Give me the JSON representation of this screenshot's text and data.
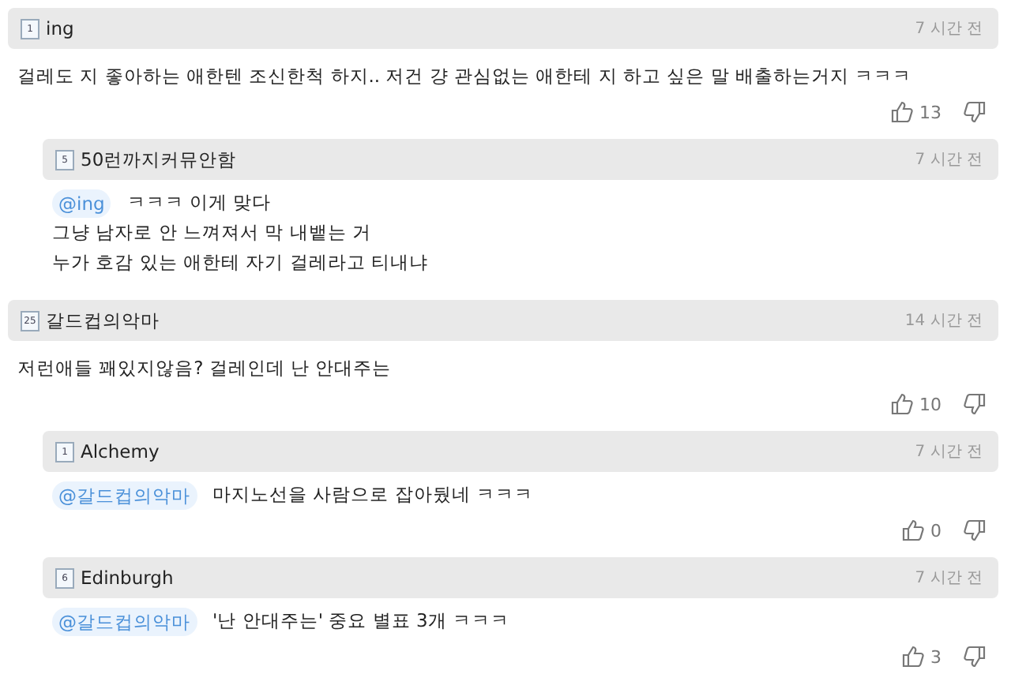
{
  "comments": [
    {
      "author": "ing",
      "badge": "1",
      "time": "7 시간 전",
      "lines": [
        "걸레도 지 좋아하는 애한텐 조신한척 하지.. 저건 걍 관심없는 애한테 지 하고 싶은 말 배출하는거지 ㅋㅋㅋ"
      ],
      "likes": "13",
      "children": [
        {
          "author": "50런까지커뮤안함",
          "badge": "5",
          "time": "7 시간 전",
          "mention": "@ing",
          "lines": [
            "ㅋㅋㅋ 이게 맞다",
            "그냥 남자로 안 느껴져서 막 내뱉는 거",
            "누가 호감 있는 애한테 자기 걸레라고 티내냐"
          ]
        }
      ]
    },
    {
      "author": "갈드컵의악마",
      "badge": "25",
      "time": "14 시간 전",
      "lines": [
        "저런애들 꽤있지않음? 걸레인데 난 안대주는"
      ],
      "likes": "10",
      "children": [
        {
          "author": "Alchemy",
          "badge": "1",
          "time": "7 시간 전",
          "mention": "@갈드컵의악마",
          "lines": [
            "마지노선을 사람으로 잡아뒀네 ㅋㅋㅋ"
          ],
          "likes": "0"
        },
        {
          "author": "Edinburgh",
          "badge": "6",
          "time": "7 시간 전",
          "mention": "@갈드컵의악마",
          "lines": [
            "'난 안대주는' 중요 별표 3개 ㅋㅋㅋ"
          ],
          "likes": "3"
        }
      ]
    }
  ]
}
